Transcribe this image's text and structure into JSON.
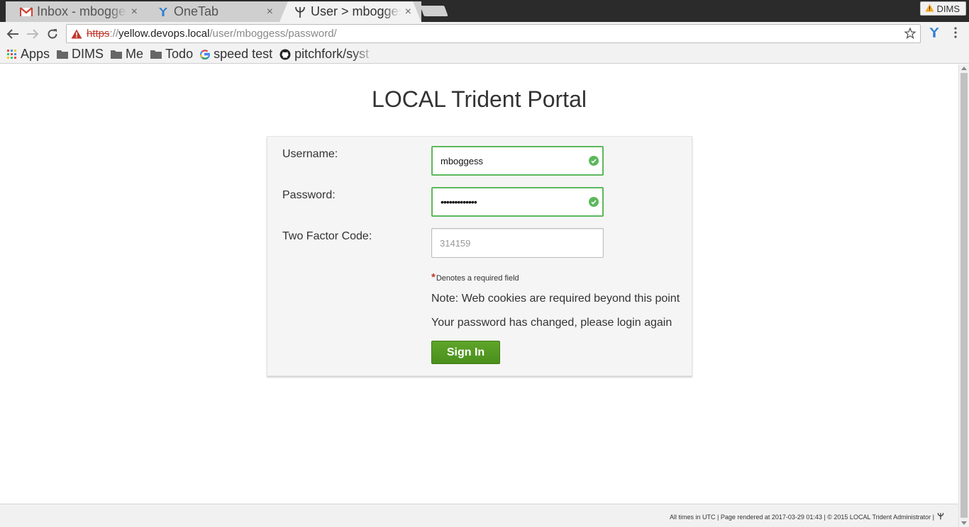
{
  "tabs": [
    {
      "title": "Inbox - mbogges",
      "icon": "gmail-icon",
      "active": false
    },
    {
      "title": "OneTab",
      "icon": "onetab-icon",
      "active": false
    },
    {
      "title": "User > mbogges",
      "icon": "trident-icon",
      "active": true
    }
  ],
  "tab_close_glyph": "×",
  "profile": {
    "label": "DIMS"
  },
  "address": {
    "scheme": "https",
    "sep": "://",
    "host": "yellow.devops.local",
    "path": "/user/mboggess/password/"
  },
  "bookmarks": [
    {
      "label": "Apps",
      "icon": "apps-grid-icon"
    },
    {
      "label": "DIMS",
      "icon": "folder-icon"
    },
    {
      "label": "Me",
      "icon": "folder-icon"
    },
    {
      "label": "Todo",
      "icon": "folder-icon"
    },
    {
      "label": "speed test",
      "icon": "google-icon"
    },
    {
      "label": "pitchfork/syst",
      "icon": "github-icon"
    }
  ],
  "page": {
    "title": "LOCAL Trident Portal",
    "form": {
      "username_label": "Username:",
      "username_value": "mboggess",
      "password_label": "Password:",
      "password_value": "•••••••••••••",
      "twofactor_label": "Two Factor Code:",
      "twofactor_placeholder": "314159",
      "required_marker": "*",
      "required_note": "Denotes a required field",
      "cookie_note": "Note: Web cookies are required beyond this point",
      "status_message": "Your password has changed, please login again",
      "signin_label": "Sign In"
    },
    "footer": {
      "text": "All times in UTC | Page rendered at 2017-03-29 01:43 | © 2015 LOCAL Trident Administrator |"
    }
  },
  "colors": {
    "valid_green": "#5cb85c",
    "signin_green": "#4a8f1c",
    "warn_red": "#c0392b"
  }
}
